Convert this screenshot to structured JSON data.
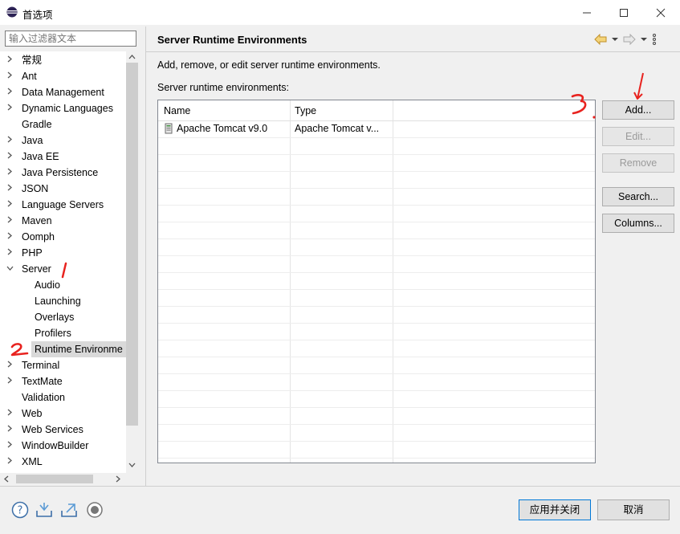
{
  "window": {
    "title": "首选项"
  },
  "filter": {
    "placeholder": "输入过滤器文本"
  },
  "tree": {
    "items": [
      {
        "label": "常规",
        "indent": 0,
        "expand": "collapsed"
      },
      {
        "label": "Ant",
        "indent": 0,
        "expand": "collapsed"
      },
      {
        "label": "Data Management",
        "indent": 0,
        "expand": "collapsed"
      },
      {
        "label": "Dynamic Languages",
        "indent": 0,
        "expand": "collapsed"
      },
      {
        "label": "Gradle",
        "indent": 0,
        "expand": "none"
      },
      {
        "label": "Java",
        "indent": 0,
        "expand": "collapsed"
      },
      {
        "label": "Java EE",
        "indent": 0,
        "expand": "collapsed"
      },
      {
        "label": "Java Persistence",
        "indent": 0,
        "expand": "collapsed"
      },
      {
        "label": "JSON",
        "indent": 0,
        "expand": "collapsed"
      },
      {
        "label": "Language Servers",
        "indent": 0,
        "expand": "collapsed"
      },
      {
        "label": "Maven",
        "indent": 0,
        "expand": "collapsed"
      },
      {
        "label": "Oomph",
        "indent": 0,
        "expand": "collapsed"
      },
      {
        "label": "PHP",
        "indent": 0,
        "expand": "collapsed"
      },
      {
        "label": "Server",
        "indent": 0,
        "expand": "expanded"
      },
      {
        "label": "Audio",
        "indent": 1,
        "expand": "none"
      },
      {
        "label": "Launching",
        "indent": 1,
        "expand": "none"
      },
      {
        "label": "Overlays",
        "indent": 1,
        "expand": "none"
      },
      {
        "label": "Profilers",
        "indent": 1,
        "expand": "none"
      },
      {
        "label": "Runtime Environme",
        "indent": 1,
        "expand": "none",
        "selected": true
      },
      {
        "label": "Terminal",
        "indent": 0,
        "expand": "collapsed"
      },
      {
        "label": "TextMate",
        "indent": 0,
        "expand": "collapsed"
      },
      {
        "label": "Validation",
        "indent": 0,
        "expand": "none"
      },
      {
        "label": "Web",
        "indent": 0,
        "expand": "collapsed"
      },
      {
        "label": "Web Services",
        "indent": 0,
        "expand": "collapsed"
      },
      {
        "label": "WindowBuilder",
        "indent": 0,
        "expand": "collapsed"
      },
      {
        "label": "XML",
        "indent": 0,
        "expand": "collapsed"
      }
    ]
  },
  "page": {
    "title": "Server Runtime Environments",
    "description": "Add, remove, or edit server runtime environments.",
    "list_label": "Server runtime environments:"
  },
  "table": {
    "columns": [
      "Name",
      "Type"
    ],
    "rows": [
      {
        "name": "Apache Tomcat v9.0",
        "type": "Apache Tomcat v..."
      }
    ]
  },
  "buttons": {
    "add": "Add...",
    "edit": "Edit...",
    "remove": "Remove",
    "search": "Search...",
    "columns": "Columns..."
  },
  "footer": {
    "apply_close": "应用并关闭",
    "cancel": "取消"
  },
  "annotations": {
    "one": "1",
    "two": "2",
    "three": "3."
  },
  "colors": {
    "annotation": "#e8231f",
    "selection": "#d9d9d9",
    "focus": "#0078d7"
  }
}
